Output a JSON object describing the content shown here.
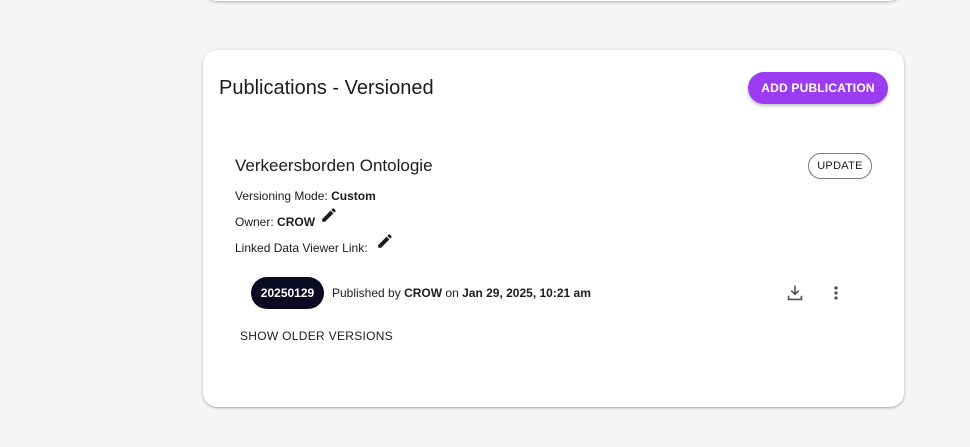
{
  "card": {
    "title": "Publications - Versioned",
    "add_button_label": "ADD PUBLICATION"
  },
  "publication": {
    "name": "Verkeersborden Ontologie",
    "update_label": "UPDATE",
    "versioning_mode_label": "Versioning Mode:",
    "versioning_mode_value": "Custom",
    "owner_label": "Owner:",
    "owner_value": "CROW",
    "linked_viewer_label": "Linked Data Viewer Link:"
  },
  "latest_version": {
    "tag": "20250129",
    "published_by_label": "Published by",
    "publisher": "CROW",
    "on_label": "on",
    "published_at": "Jan 29, 2025, 10:21 am"
  },
  "show_older_label": "SHOW OLDER VERSIONS",
  "icons": {
    "edit": "pencil-icon",
    "download": "download-icon",
    "more": "more-vertical-icon"
  },
  "colors": {
    "accent": "#9b3cf2",
    "chip": "#0d0b24"
  }
}
